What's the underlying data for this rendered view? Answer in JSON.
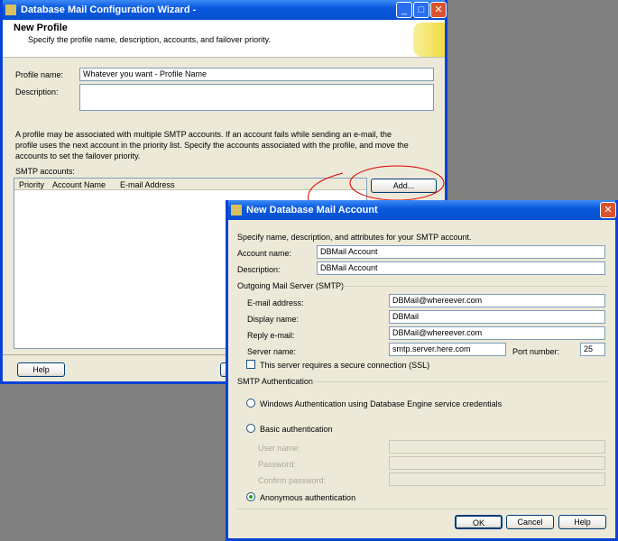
{
  "wizard": {
    "title": "Database Mail Configuration Wizard -",
    "heading": "New Profile",
    "subheading": "Specify the profile name, description, accounts, and failover priority.",
    "profile_name_label": "Profile name:",
    "profile_name_value": "Whatever you want - Profile Name",
    "description_label": "Description:",
    "info_text": "A profile may be associated with multiple SMTP accounts. If an account fails while sending an e-mail, the profile uses the next account in the priority list. Specify the accounts associated with the profile, and move the accounts to set the failover priority.",
    "smtp_accounts_label": "SMTP accounts:",
    "columns": [
      "Priority",
      "Account Name",
      "E-mail Address"
    ],
    "add_button": "Add...",
    "help_button": "Help"
  },
  "dialog": {
    "title": "New Database Mail Account",
    "intro": "Specify name, description, and attributes for your SMTP account.",
    "account_name_label": "Account name:",
    "account_name_value": "DBMail Account",
    "description_label": "Description:",
    "description_value": "DBMail Account",
    "outgoing_group": "Outgoing Mail Server (SMTP)",
    "email_label": "E-mail address:",
    "email_value": "DBMail@whereever.com",
    "display_label": "Display name:",
    "display_value": "DBMail",
    "reply_label": "Reply e-mail:",
    "reply_value": "DBMail@whereever.com",
    "server_label": "Server name:",
    "server_value": "smtp.server.here.com",
    "port_label": "Port number:",
    "port_value": "25",
    "ssl_label": "This server requires a secure connection (SSL)",
    "ssl_checked": false,
    "auth_group": "SMTP Authentication",
    "auth_windows": "Windows Authentication using Database Engine service credentials",
    "auth_basic": "Basic authentication",
    "user_label": "User name:",
    "password_label": "Password:",
    "confirm_label": "Confirm password:",
    "auth_anonymous": "Anonymous authentication",
    "selected_auth": "anonymous",
    "ok": "OK",
    "cancel": "Cancel",
    "help": "Help"
  },
  "annotation_color": "#e00000"
}
